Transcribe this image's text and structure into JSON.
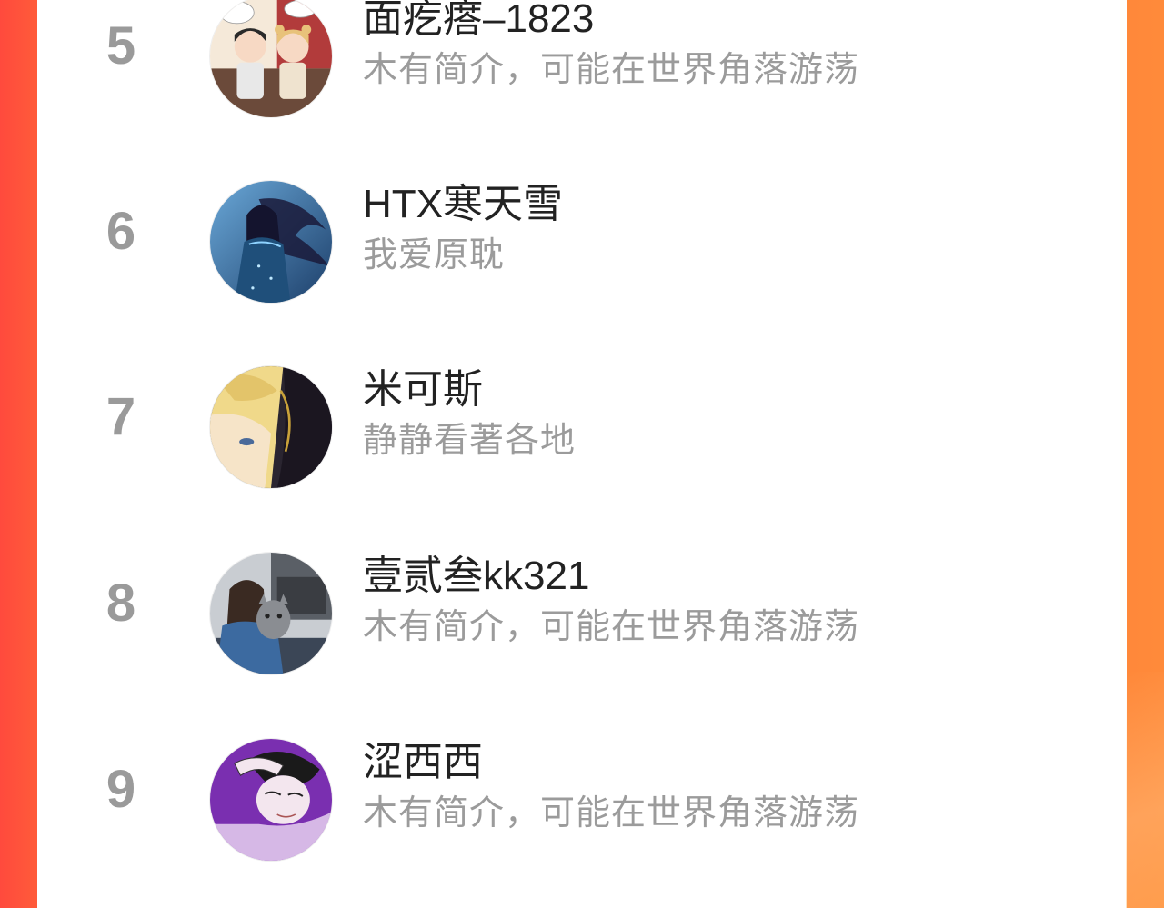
{
  "ranking": {
    "items": [
      {
        "rank": "5",
        "name": "面疙瘩–1823",
        "bio": "木有简介，可能在世界角落游荡",
        "avatar": "avatar-cartoon-couple"
      },
      {
        "rank": "6",
        "name": "HTX寒天雪",
        "bio": "我爱原耽",
        "avatar": "avatar-anime-blue-dress"
      },
      {
        "rank": "7",
        "name": "米可斯",
        "bio": "静静看著各地",
        "avatar": "avatar-anime-blonde"
      },
      {
        "rank": "8",
        "name": "壹贰叁kk321",
        "bio": "木有简介，可能在世界角落游荡",
        "avatar": "avatar-photo-cat"
      },
      {
        "rank": "9",
        "name": "涩西西",
        "bio": "木有简介，可能在世界角落游荡",
        "avatar": "avatar-manga-purple"
      }
    ]
  },
  "colors": {
    "background_gradient_start": "#ff4a3d",
    "background_gradient_end": "#ff8a3a",
    "panel": "#ffffff",
    "rank_number": "#9a9a9a",
    "name_text": "#222222",
    "bio_text": "#9b9b9b"
  }
}
